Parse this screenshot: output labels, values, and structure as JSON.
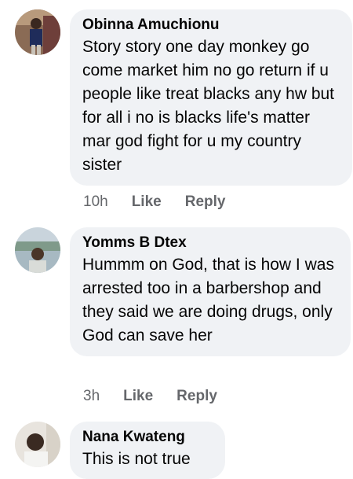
{
  "comments": [
    {
      "author": "Obinna Amuchionu",
      "text": "Story story one day monkey go come market him no go return if u people like treat blacks any hw but for all i no is blacks life's matter mar god fight for u my country sister",
      "time": "10h",
      "like_label": "Like",
      "reply_label": "Reply"
    },
    {
      "author": "Yomms B Dtex",
      "text": "Hummm on God, that is how I was arrested too in a barbershop and they said we are doing drugs, only God can save her",
      "time": "3h",
      "like_label": "Like",
      "reply_label": "Reply"
    },
    {
      "author": "Nana Kwateng",
      "text": "This is not true"
    }
  ],
  "colors": {
    "bubble_bg": "#f0f2f5",
    "text": "#050505",
    "secondary": "#65676b"
  }
}
